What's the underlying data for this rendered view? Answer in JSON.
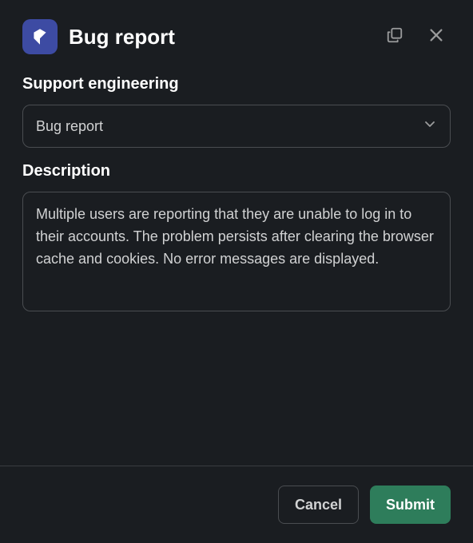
{
  "header": {
    "title": "Bug report"
  },
  "fields": {
    "category": {
      "label": "Support engineering",
      "value": "Bug report"
    },
    "description": {
      "label": "Description",
      "value": "Multiple users are reporting that they are unable to log in to their accounts. The problem persists after clearing the browser cache and cookies. No error messages are displayed."
    }
  },
  "footer": {
    "cancel": "Cancel",
    "submit": "Submit"
  }
}
